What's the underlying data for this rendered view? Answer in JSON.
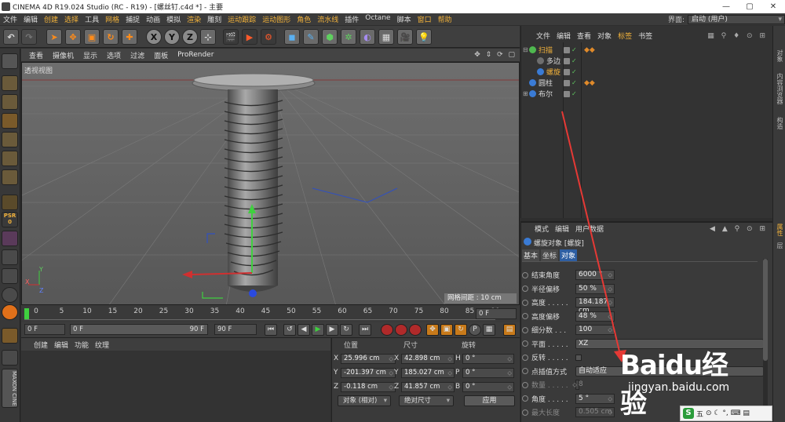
{
  "window": {
    "title": "CINEMA 4D R19.024 Studio (RC - R19) - [螺丝钉.c4d *] - 主要",
    "controls": [
      "—",
      "▢",
      "✕"
    ]
  },
  "menubar": {
    "items": [
      {
        "label": "文件",
        "hl": false
      },
      {
        "label": "编辑",
        "hl": false
      },
      {
        "label": "创建",
        "hl": true
      },
      {
        "label": "选择",
        "hl": true
      },
      {
        "label": "工具",
        "hl": false
      },
      {
        "label": "网格",
        "hl": true
      },
      {
        "label": "捕捉",
        "hl": false
      },
      {
        "label": "动画",
        "hl": false
      },
      {
        "label": "模拟",
        "hl": false
      },
      {
        "label": "渲染",
        "hl": true
      },
      {
        "label": "雕刻",
        "hl": false
      },
      {
        "label": "运动跟踪",
        "hl": true
      },
      {
        "label": "运动图形",
        "hl": true
      },
      {
        "label": "角色",
        "hl": true
      },
      {
        "label": "流水线",
        "hl": true
      },
      {
        "label": "插件",
        "hl": false
      },
      {
        "label": "Octane",
        "hl": false
      },
      {
        "label": "脚本",
        "hl": false
      },
      {
        "label": "窗口",
        "hl": true
      },
      {
        "label": "帮助",
        "hl": true
      }
    ],
    "layout_label": "界面:",
    "layout_value": "启动 (用户)"
  },
  "toolbar": {
    "x_label": "X",
    "y_label": "Y",
    "z_label": "Z",
    "icons": [
      "undo-icon",
      "redo-icon",
      "select-icon",
      "move-icon",
      "scale-icon",
      "rotate-icon",
      "add-icon",
      "x-axis-icon",
      "y-axis-icon",
      "z-axis-icon",
      "coord-system-icon",
      "render-view-icon",
      "render-picture-viewer-icon",
      "render-settings-icon",
      "cube-icon",
      "pen-icon",
      "subdivision-icon",
      "array-icon",
      "deformer-icon",
      "floor-icon",
      "camera-icon",
      "light-icon"
    ]
  },
  "viewport": {
    "menu": [
      "查看",
      "摄像机",
      "显示",
      "选项",
      "过滤",
      "面板",
      "ProRender"
    ],
    "nav_icons": "✥ ⇕ ⟳ ▢",
    "label": "透视视图",
    "grid_spacing": "网格间距 : 10 cm",
    "axis_x": "X",
    "axis_y": "Y",
    "axis_z": "Z"
  },
  "timeline": {
    "ticks": [
      "0",
      "5",
      "10",
      "15",
      "20",
      "25",
      "30",
      "35",
      "40",
      "45",
      "50",
      "55",
      "60",
      "65",
      "70",
      "75",
      "80",
      "85",
      "90"
    ],
    "current_frame": "0 F"
  },
  "playback": {
    "start": "0 F",
    "slider_start": "0 F",
    "slider_end": "90 F",
    "end": "90 F"
  },
  "material": {
    "menu": [
      "创建",
      "编辑",
      "功能",
      "纹理"
    ]
  },
  "coordinates": {
    "headers": {
      "position": "位置",
      "size": "尺寸",
      "rotation": "旋转"
    },
    "rows": [
      {
        "axis": "X",
        "pos": "25.996 cm",
        "saxis": "X",
        "size": "42.898 cm",
        "raxis": "H",
        "rot": "0 °"
      },
      {
        "axis": "Y",
        "pos": "-201.397 cm",
        "saxis": "Y",
        "size": "185.027 cm",
        "raxis": "P",
        "rot": "0 °"
      },
      {
        "axis": "Z",
        "pos": "-0.118 cm",
        "saxis": "Z",
        "size": "41.857 cm",
        "raxis": "B",
        "rot": "0 °"
      }
    ],
    "mode": "对象 (相对)",
    "size_mode": "绝对尺寸",
    "apply": "应用"
  },
  "objects": {
    "menu": [
      {
        "label": "文件",
        "hl": false
      },
      {
        "label": "编辑",
        "hl": false
      },
      {
        "label": "查看",
        "hl": false
      },
      {
        "label": "对象",
        "hl": false
      },
      {
        "label": "标签",
        "hl": true
      },
      {
        "label": "书签",
        "hl": false
      }
    ],
    "tree": [
      {
        "name": "扫描",
        "color": "#f2b23b",
        "icon": "#4fb84f",
        "exp": "⊟",
        "indent": 0,
        "tag": true
      },
      {
        "name": "多边",
        "color": "#dddddd",
        "icon": "#6e6e6e",
        "exp": "",
        "indent": 1,
        "tag": false
      },
      {
        "name": "螺旋",
        "color": "#f2b23b",
        "icon": "#3a7bd5",
        "exp": "",
        "indent": 1,
        "tag": false
      },
      {
        "name": "圆柱",
        "color": "#dddddd",
        "icon": "#3a7bd5",
        "exp": "",
        "indent": 0,
        "tag": true
      },
      {
        "name": "布尔",
        "color": "#dddddd",
        "icon": "#3a7bd5",
        "exp": "⊞",
        "indent": 0,
        "tag": false
      }
    ]
  },
  "attributes": {
    "menu": [
      "模式",
      "编辑",
      "用户数据"
    ],
    "title": "螺旋对象 [螺旋]",
    "tabs": [
      {
        "label": "基本",
        "sel": false
      },
      {
        "label": "坐标",
        "sel": false
      },
      {
        "label": "对象",
        "sel": true
      }
    ],
    "rows": [
      {
        "label": "结束角度",
        "value": "6000 °",
        "dim": false
      },
      {
        "label": "半径偏移",
        "value": "50 %",
        "dim": false
      },
      {
        "label": "高度 . . . . .",
        "value": "184.187 cm",
        "dim": false
      },
      {
        "label": "高度偏移",
        "value": "48 %",
        "dim": false
      },
      {
        "label": "细分数 . . .",
        "value": "100",
        "dim": false
      },
      {
        "label": "平面 . . . . .",
        "value": "XZ",
        "dim": false
      },
      {
        "label": "反转 . . . . .",
        "value": "",
        "dim": false
      },
      {
        "label": "点插值方式",
        "value": "自动适应",
        "dim": false
      },
      {
        "label": "数量 . . . . .",
        "value": "8",
        "dim": true
      },
      {
        "label": "角度 . . . . .",
        "value": "5 °",
        "dim": false
      },
      {
        "label": "最大长度",
        "value": "0.505 cm",
        "dim": true
      }
    ]
  },
  "right_tabs": [
    "对象",
    "内容浏览器",
    "构造",
    "属性",
    "层"
  ],
  "watermark": {
    "brand": "Baidu经验",
    "url": "jingyan.baidu.com"
  },
  "ime": {
    "label": "五",
    "icons": "⊙ ☾ °, ⌨ ▤"
  },
  "colors": {
    "accent": "#f2b23b",
    "selected_tab": "#2e5fa3",
    "arrow": "#e53935"
  }
}
